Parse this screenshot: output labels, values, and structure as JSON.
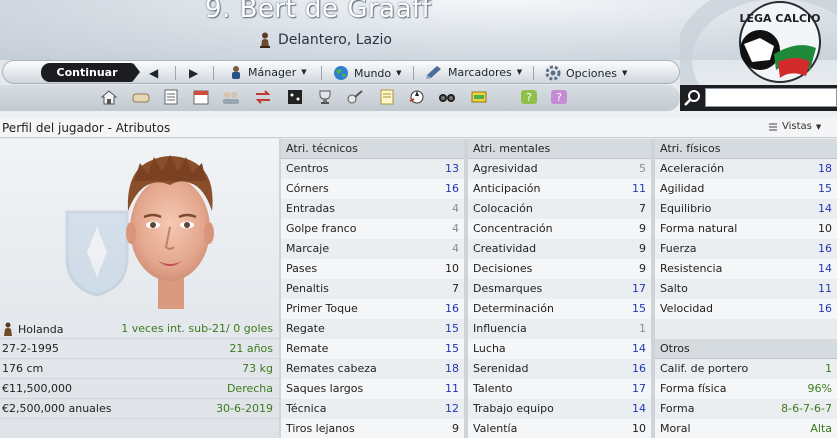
{
  "header": {
    "title": "9. Bert de Graaff",
    "subtitle": "Delantero, Lazio",
    "logo_text": "LEGA CALCIO"
  },
  "nav": {
    "continue_label": "Continuar",
    "items": [
      {
        "label": "Mánager",
        "icon": "manager-icon"
      },
      {
        "label": "Mundo",
        "icon": "globe-icon"
      },
      {
        "label": "Marcadores",
        "icon": "bookmark-icon"
      },
      {
        "label": "Opciones",
        "icon": "options-icon"
      }
    ]
  },
  "search": {
    "placeholder": ""
  },
  "section": {
    "title": "Perfil del jugador - Atributos",
    "views_label": "Vistas"
  },
  "profile": {
    "rows": [
      {
        "left": "Holanda",
        "right": "1 veces int. sub-21/ 0 goles"
      },
      {
        "left": "27-2-1995",
        "right": "21 años"
      },
      {
        "left": "176 cm",
        "right": "73 kg"
      },
      {
        "left": "€11,500,000",
        "right": "Derecha"
      },
      {
        "left": "€2,500,000 anuales",
        "right": "30-6-2019"
      }
    ]
  },
  "technical": {
    "header": "Atri. técnicos",
    "rows": [
      {
        "name": "Centros",
        "value": "13"
      },
      {
        "name": "Córners",
        "value": "16"
      },
      {
        "name": "Entradas",
        "value": "4"
      },
      {
        "name": "Golpe franco",
        "value": "4"
      },
      {
        "name": "Marcaje",
        "value": "4"
      },
      {
        "name": "Pases",
        "value": "10"
      },
      {
        "name": "Penaltis",
        "value": "7"
      },
      {
        "name": "Primer Toque",
        "value": "16"
      },
      {
        "name": "Regate",
        "value": "15"
      },
      {
        "name": "Remate",
        "value": "15"
      },
      {
        "name": "Remates cabeza",
        "value": "18"
      },
      {
        "name": "Saques largos",
        "value": "11"
      },
      {
        "name": "Técnica",
        "value": "12"
      },
      {
        "name": "Tiros lejanos",
        "value": "9"
      }
    ]
  },
  "mental": {
    "header": "Atri. mentales",
    "rows": [
      {
        "name": "Agresividad",
        "value": "5"
      },
      {
        "name": "Anticipación",
        "value": "11"
      },
      {
        "name": "Colocación",
        "value": "7"
      },
      {
        "name": "Concentración",
        "value": "9"
      },
      {
        "name": "Creatividad",
        "value": "9"
      },
      {
        "name": "Decisiones",
        "value": "9"
      },
      {
        "name": "Desmarques",
        "value": "17"
      },
      {
        "name": "Determinación",
        "value": "15"
      },
      {
        "name": "Influencia",
        "value": "1"
      },
      {
        "name": "Lucha",
        "value": "14"
      },
      {
        "name": "Serenidad",
        "value": "16"
      },
      {
        "name": "Talento",
        "value": "17"
      },
      {
        "name": "Trabajo equipo",
        "value": "14"
      },
      {
        "name": "Valentía",
        "value": "10"
      }
    ]
  },
  "physical": {
    "header": "Atri. físicos",
    "rows": [
      {
        "name": "Aceleración",
        "value": "18"
      },
      {
        "name": "Agilidad",
        "value": "15"
      },
      {
        "name": "Equilibrio",
        "value": "14"
      },
      {
        "name": "Forma natural",
        "value": "10"
      },
      {
        "name": "Fuerza",
        "value": "16"
      },
      {
        "name": "Resistencia",
        "value": "14"
      },
      {
        "name": "Salto",
        "value": "11"
      },
      {
        "name": "Velocidad",
        "value": "16"
      }
    ]
  },
  "others": {
    "header": "Otros",
    "rows": [
      {
        "name": "Calif. de portero",
        "value": "1"
      },
      {
        "name": "Forma física",
        "value": "96%"
      },
      {
        "name": "Forma",
        "value": "8-6-7-6-7"
      },
      {
        "name": "Moral",
        "value": "Alta"
      }
    ]
  }
}
